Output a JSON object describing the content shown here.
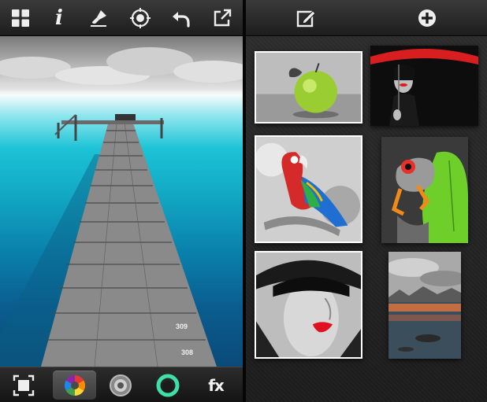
{
  "left_panel": {
    "toolbar": {
      "items": [
        {
          "icon": "grid-icon"
        },
        {
          "icon": "info-icon",
          "glyph": "i"
        },
        {
          "icon": "brush-icon"
        },
        {
          "icon": "target-icon"
        },
        {
          "icon": "undo-icon"
        },
        {
          "icon": "share-icon"
        }
      ]
    },
    "photo": {
      "subject": "pier-over-turquoise-sea",
      "pier_numbers": [
        "309",
        "308"
      ]
    },
    "bottom_toolbar": {
      "items": [
        {
          "icon": "fit-screen-icon",
          "active": false
        },
        {
          "icon": "color-wheel-icon",
          "active": true
        },
        {
          "icon": "gray-wheel-icon",
          "active": false
        },
        {
          "icon": "green-wheel-icon",
          "active": false
        },
        {
          "icon": "fx-icon",
          "label": "fx",
          "active": false
        }
      ]
    }
  },
  "right_panel": {
    "toolbar": {
      "items": [
        {
          "icon": "edit-icon"
        },
        {
          "icon": "add-icon"
        }
      ]
    },
    "gallery": [
      {
        "subject": "green-apple",
        "accent": "#9acd32"
      },
      {
        "subject": "woman-red-umbrella",
        "accent": "#d81e1e"
      },
      {
        "subject": "parrot",
        "accent": "#d42a2a"
      },
      {
        "subject": "tree-frog",
        "accent": "#6fcf2a"
      },
      {
        "subject": "woman-red-lips",
        "accent": "#e01020"
      },
      {
        "subject": "lake-landscape",
        "accent": "#f07a3a"
      }
    ]
  },
  "colors": {
    "toolbar_top": "#3a3a3a",
    "toolbar_bottom": "#1d1d1d",
    "sea": "#12a8c4",
    "active_tool": "#4a4a4a"
  }
}
